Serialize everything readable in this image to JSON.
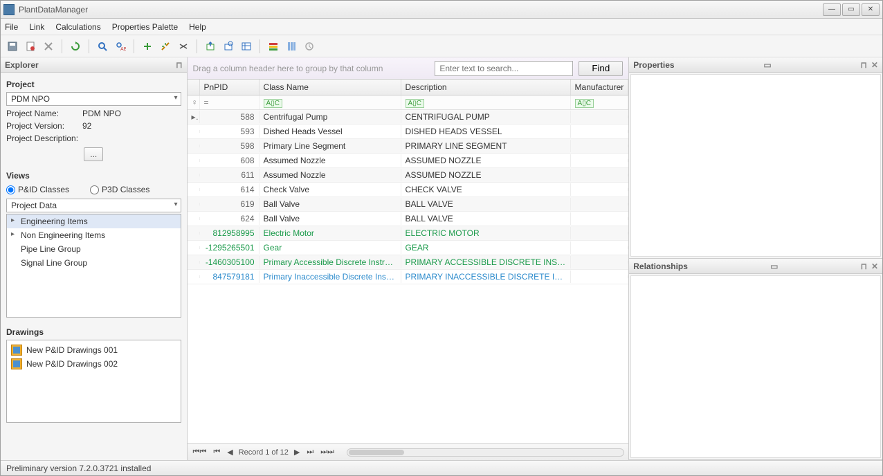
{
  "title": "PlantDataManager",
  "menu": [
    "File",
    "Link",
    "Calculations",
    "Properties Palette",
    "Help"
  ],
  "explorer": {
    "title": "Explorer",
    "project_label": "Project",
    "project_combo": "PDM NPO",
    "project_name_label": "Project Name:",
    "project_name": "PDM NPO",
    "project_version_label": "Project Version:",
    "project_version": "92",
    "project_desc_label": "Project Description:",
    "more_btn": "...",
    "views_label": "Views",
    "radio_pid": "P&ID Classes",
    "radio_p3d": "P3D Classes",
    "tree_combo": "Project Data",
    "tree": [
      {
        "label": "Engineering Items",
        "expandable": true,
        "selected": true
      },
      {
        "label": "Non Engineering Items",
        "expandable": true
      },
      {
        "label": "Pipe Line Group"
      },
      {
        "label": "Signal Line Group"
      }
    ],
    "drawings_label": "Drawings",
    "drawings": [
      "New P&ID Drawings 001",
      "New P&ID Drawings 002"
    ]
  },
  "grid": {
    "group_hint": "Drag a column header here to group by that column",
    "search_placeholder": "Enter text to search...",
    "find_label": "Find",
    "columns": [
      "PnPID",
      "Class Name",
      "Description",
      "Manufacturer"
    ],
    "rows": [
      {
        "marker": "▸",
        "pnpid": "588",
        "class": "Centrifugal Pump",
        "desc": "CENTRIFUGAL PUMP",
        "style": ""
      },
      {
        "marker": "",
        "pnpid": "593",
        "class": "Dished Heads Vessel",
        "desc": "DISHED HEADS VESSEL",
        "style": ""
      },
      {
        "marker": "",
        "pnpid": "598",
        "class": "Primary Line Segment",
        "desc": "PRIMARY LINE SEGMENT",
        "style": ""
      },
      {
        "marker": "",
        "pnpid": "608",
        "class": "Assumed Nozzle",
        "desc": "ASSUMED NOZZLE",
        "style": ""
      },
      {
        "marker": "",
        "pnpid": "611",
        "class": "Assumed Nozzle",
        "desc": "ASSUMED NOZZLE",
        "style": ""
      },
      {
        "marker": "",
        "pnpid": "614",
        "class": "Check Valve",
        "desc": "CHECK VALVE",
        "style": ""
      },
      {
        "marker": "",
        "pnpid": "619",
        "class": "Ball Valve",
        "desc": "BALL VALVE",
        "style": ""
      },
      {
        "marker": "",
        "pnpid": "624",
        "class": "Ball Valve",
        "desc": "BALL VALVE",
        "style": ""
      },
      {
        "marker": "",
        "pnpid": "812958995",
        "class": "Electric Motor",
        "desc": "ELECTRIC MOTOR",
        "style": "green"
      },
      {
        "marker": "",
        "pnpid": "-1295265501",
        "class": "Gear",
        "desc": "GEAR",
        "style": "green"
      },
      {
        "marker": "",
        "pnpid": "-1460305100",
        "class": "Primary Accessible Discrete Instrument",
        "desc": "PRIMARY ACCESSIBLE DISCRETE INSTRUMENT",
        "style": "green"
      },
      {
        "marker": "",
        "pnpid": "847579181",
        "class": "Primary Inaccessible Discrete Instrument",
        "desc": "PRIMARY INACCESSIBLE DISCRETE INSTRUMENT",
        "style": "blue"
      }
    ],
    "nav_text": "Record 1 of 12"
  },
  "properties_title": "Properties",
  "relationships_title": "Relationships",
  "status": "Preliminary version 7.2.0.3721 installed"
}
